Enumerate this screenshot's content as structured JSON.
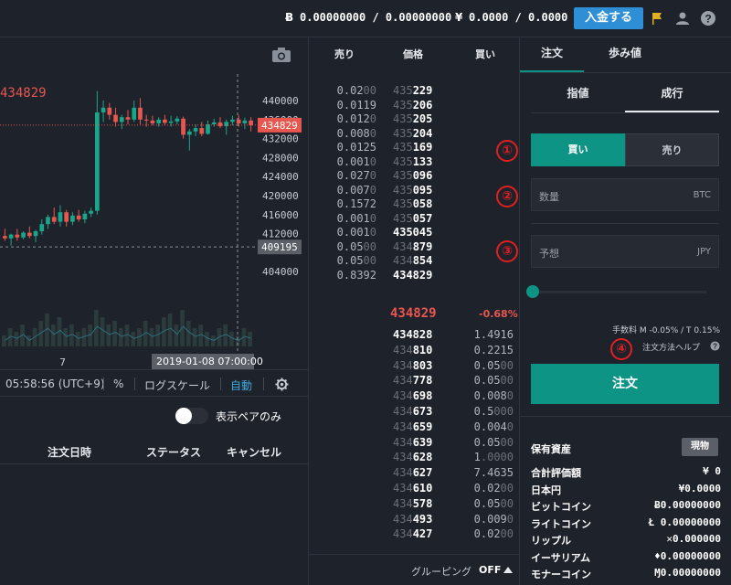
{
  "header": {
    "btc_balance": "0.00000000 / 0.00000000",
    "jpy_balance": "0.0000 / 0.0000",
    "deposit_label": "入金する",
    "accent": "#2e8fd6"
  },
  "chart": {
    "last_price_label": "434829",
    "price_ticks": [
      "440000",
      "436000",
      "432000",
      "428000",
      "424000",
      "420000",
      "416000",
      "412000",
      "404000"
    ],
    "current_price_tag": "434829",
    "crosshair_price_tag": "409195",
    "date_tick": "7",
    "crosshair_time": "2019-01-08 07:00:00",
    "toolbar": {
      "time": "05:58:56 (UTC+9)",
      "percent": "%",
      "log_scale": "ログスケール",
      "auto": "自動"
    }
  },
  "orders": {
    "toggle_label": "表示ペアのみ",
    "columns": [
      "注文日時",
      "ステータス",
      "キャンセル"
    ]
  },
  "book": {
    "headers": {
      "sell": "売り",
      "price": "価格",
      "buy": "買い"
    },
    "asks": [
      {
        "qty_a": "0.02",
        "qty_b": "00",
        "price_a": "435",
        "price_b": "229"
      },
      {
        "qty_a": "0.0119",
        "qty_b": "",
        "price_a": "435",
        "price_b": "206"
      },
      {
        "qty_a": "0.012",
        "qty_b": "0",
        "price_a": "435",
        "price_b": "205"
      },
      {
        "qty_a": "0.008",
        "qty_b": "0",
        "price_a": "435",
        "price_b": "204"
      },
      {
        "qty_a": "0.0125",
        "qty_b": "",
        "price_a": "435",
        "price_b": "169"
      },
      {
        "qty_a": "0.001",
        "qty_b": "0",
        "price_a": "435",
        "price_b": "133"
      },
      {
        "qty_a": "0.027",
        "qty_b": "0",
        "price_a": "435",
        "price_b": "096"
      },
      {
        "qty_a": "0.007",
        "qty_b": "0",
        "price_a": "435",
        "price_b": "095"
      },
      {
        "qty_a": "0.1572",
        "qty_b": "",
        "price_a": "435",
        "price_b": "058"
      },
      {
        "qty_a": "0.001",
        "qty_b": "0",
        "price_a": "435",
        "price_b": "057"
      },
      {
        "qty_a": "0.001",
        "qty_b": "0",
        "price_a": "",
        "price_b": "435045"
      },
      {
        "qty_a": "0.05",
        "qty_b": "00",
        "price_a": "434",
        "price_b": "879"
      },
      {
        "qty_a": "0.05",
        "qty_b": "00",
        "price_a": "434",
        "price_b": "854"
      },
      {
        "qty_a": "0.8392",
        "qty_b": "",
        "price_a": "",
        "price_b": "434829"
      }
    ],
    "mid_price": "434829",
    "mid_change": "-0.68%",
    "bids": [
      {
        "price_a": "",
        "price_b": "434828",
        "qty_a": "1.4916",
        "qty_b": ""
      },
      {
        "price_a": "434",
        "price_b": "810",
        "qty_a": "0.2215",
        "qty_b": ""
      },
      {
        "price_a": "434",
        "price_b": "803",
        "qty_a": "0.05",
        "qty_b": "00"
      },
      {
        "price_a": "434",
        "price_b": "778",
        "qty_a": "0.05",
        "qty_b": "00"
      },
      {
        "price_a": "434",
        "price_b": "698",
        "qty_a": "0.008",
        "qty_b": "0"
      },
      {
        "price_a": "434",
        "price_b": "673",
        "qty_a": "0.5",
        "qty_b": "000"
      },
      {
        "price_a": "434",
        "price_b": "659",
        "qty_a": "0.004",
        "qty_b": "0"
      },
      {
        "price_a": "434",
        "price_b": "639",
        "qty_a": "0.05",
        "qty_b": "00"
      },
      {
        "price_a": "434",
        "price_b": "628",
        "qty_a": "1",
        "qty_b": ".0000"
      },
      {
        "price_a": "434",
        "price_b": "627",
        "qty_a": "7.4635",
        "qty_b": ""
      },
      {
        "price_a": "434",
        "price_b": "610",
        "qty_a": "0.02",
        "qty_b": "00"
      },
      {
        "price_a": "434",
        "price_b": "578",
        "qty_a": "0.05",
        "qty_b": "00"
      },
      {
        "price_a": "434",
        "price_b": "493",
        "qty_a": "0.009",
        "qty_b": "0"
      },
      {
        "price_a": "434",
        "price_b": "427",
        "qty_a": "0.02",
        "qty_b": "00"
      }
    ],
    "grouping_label": "グルーピング",
    "grouping_value": "OFF"
  },
  "trade": {
    "tabs": [
      "注文",
      "歩み値"
    ],
    "order_types": [
      "指値",
      "成行"
    ],
    "buy_label": "買い",
    "sell_label": "売り",
    "qty_placeholder": "数量",
    "qty_unit": "BTC",
    "est_placeholder": "予想",
    "est_unit": "JPY",
    "fee_text": "手数料 M -0.05% / T 0.15%",
    "help_text": "注文方法ヘルプ",
    "submit_label": "注文",
    "accent": "#0e9484",
    "badges": [
      "①",
      "②",
      "③",
      "④"
    ],
    "assets": {
      "title": "保有資産",
      "kind": "現物",
      "rows": [
        {
          "label": "合計評価額",
          "value": "¥ 0"
        },
        {
          "label": "日本円",
          "value": "¥0.0000"
        },
        {
          "label": "ビットコイン",
          "value": "Ƀ0.00000000"
        },
        {
          "label": "ライトコイン",
          "value": "Ł 0.00000000"
        },
        {
          "label": "リップル",
          "value": "✕0.000000"
        },
        {
          "label": "イーサリアム",
          "value": "♦0.00000000"
        },
        {
          "label": "モナーコイン",
          "value": "Ɱ0.00000000"
        }
      ]
    }
  },
  "candles": [
    {
      "o": 411500,
      "h": 413000,
      "l": 410500,
      "c": 411000
    },
    {
      "o": 411000,
      "h": 412000,
      "l": 409500,
      "c": 411800
    },
    {
      "o": 411800,
      "h": 413000,
      "l": 410500,
      "c": 411200
    },
    {
      "o": 411200,
      "h": 412500,
      "l": 410800,
      "c": 412200
    },
    {
      "o": 412200,
      "h": 413500,
      "l": 411000,
      "c": 411500
    },
    {
      "o": 411500,
      "h": 412800,
      "l": 410200,
      "c": 412500
    },
    {
      "o": 412500,
      "h": 415000,
      "l": 411800,
      "c": 414000
    },
    {
      "o": 414000,
      "h": 416000,
      "l": 413000,
      "c": 415500
    },
    {
      "o": 415500,
      "h": 417500,
      "l": 414000,
      "c": 414500
    },
    {
      "o": 414500,
      "h": 418000,
      "l": 413500,
      "c": 416500
    },
    {
      "o": 416500,
      "h": 417000,
      "l": 413500,
      "c": 414500
    },
    {
      "o": 414500,
      "h": 416500,
      "l": 413800,
      "c": 415800
    },
    {
      "o": 415800,
      "h": 417000,
      "l": 414500,
      "c": 415000
    },
    {
      "o": 415000,
      "h": 416800,
      "l": 414200,
      "c": 416200
    },
    {
      "o": 416200,
      "h": 417500,
      "l": 415500,
      "c": 416800
    },
    {
      "o": 416800,
      "h": 442000,
      "l": 416000,
      "c": 437500
    },
    {
      "o": 437500,
      "h": 440000,
      "l": 435500,
      "c": 438500
    },
    {
      "o": 438500,
      "h": 439500,
      "l": 436000,
      "c": 437000
    },
    {
      "o": 437000,
      "h": 438500,
      "l": 434500,
      "c": 435500
    },
    {
      "o": 435500,
      "h": 437000,
      "l": 434000,
      "c": 436500
    },
    {
      "o": 436500,
      "h": 438000,
      "l": 435000,
      "c": 436000
    },
    {
      "o": 436000,
      "h": 440000,
      "l": 435500,
      "c": 438500
    },
    {
      "o": 438500,
      "h": 440500,
      "l": 435000,
      "c": 436000
    },
    {
      "o": 436000,
      "h": 437000,
      "l": 434500,
      "c": 435800
    },
    {
      "o": 435800,
      "h": 436800,
      "l": 434800,
      "c": 435200
    },
    {
      "o": 435200,
      "h": 436500,
      "l": 434500,
      "c": 436000
    },
    {
      "o": 436000,
      "h": 437000,
      "l": 434800,
      "c": 435300
    },
    {
      "o": 435300,
      "h": 436800,
      "l": 434500,
      "c": 435600
    },
    {
      "o": 435600,
      "h": 436700,
      "l": 435000,
      "c": 436200
    },
    {
      "o": 436200,
      "h": 436600,
      "l": 432000,
      "c": 432800
    },
    {
      "o": 432800,
      "h": 434000,
      "l": 429500,
      "c": 433500
    },
    {
      "o": 433500,
      "h": 435000,
      "l": 432500,
      "c": 434200
    },
    {
      "o": 434200,
      "h": 435500,
      "l": 432500,
      "c": 433000
    },
    {
      "o": 433000,
      "h": 435800,
      "l": 432800,
      "c": 435000
    },
    {
      "o": 435000,
      "h": 436200,
      "l": 434500,
      "c": 435400
    },
    {
      "o": 435400,
      "h": 436500,
      "l": 434200,
      "c": 434600
    },
    {
      "o": 434600,
      "h": 436000,
      "l": 432800,
      "c": 435500
    },
    {
      "o": 435500,
      "h": 436800,
      "l": 434800,
      "c": 436000
    },
    {
      "o": 436000,
      "h": 437000,
      "l": 434500,
      "c": 435200
    },
    {
      "o": 435200,
      "h": 436400,
      "l": 434000,
      "c": 435800
    },
    {
      "o": 435800,
      "h": 436500,
      "l": 433500,
      "c": 434829
    }
  ],
  "volumes": [
    0.3,
    0.5,
    0.4,
    0.6,
    0.3,
    0.5,
    0.7,
    0.9,
    0.6,
    0.8,
    0.5,
    0.6,
    0.4,
    0.5,
    0.6,
    1.0,
    0.8,
    0.6,
    0.7,
    0.5,
    0.6,
    0.4,
    0.5,
    0.7,
    0.5,
    0.6,
    0.8,
    0.9,
    0.6,
    1.0,
    0.7,
    0.5,
    0.6,
    0.4,
    0.3,
    0.5,
    0.6,
    0.4,
    0.3,
    0.5,
    0.4
  ]
}
